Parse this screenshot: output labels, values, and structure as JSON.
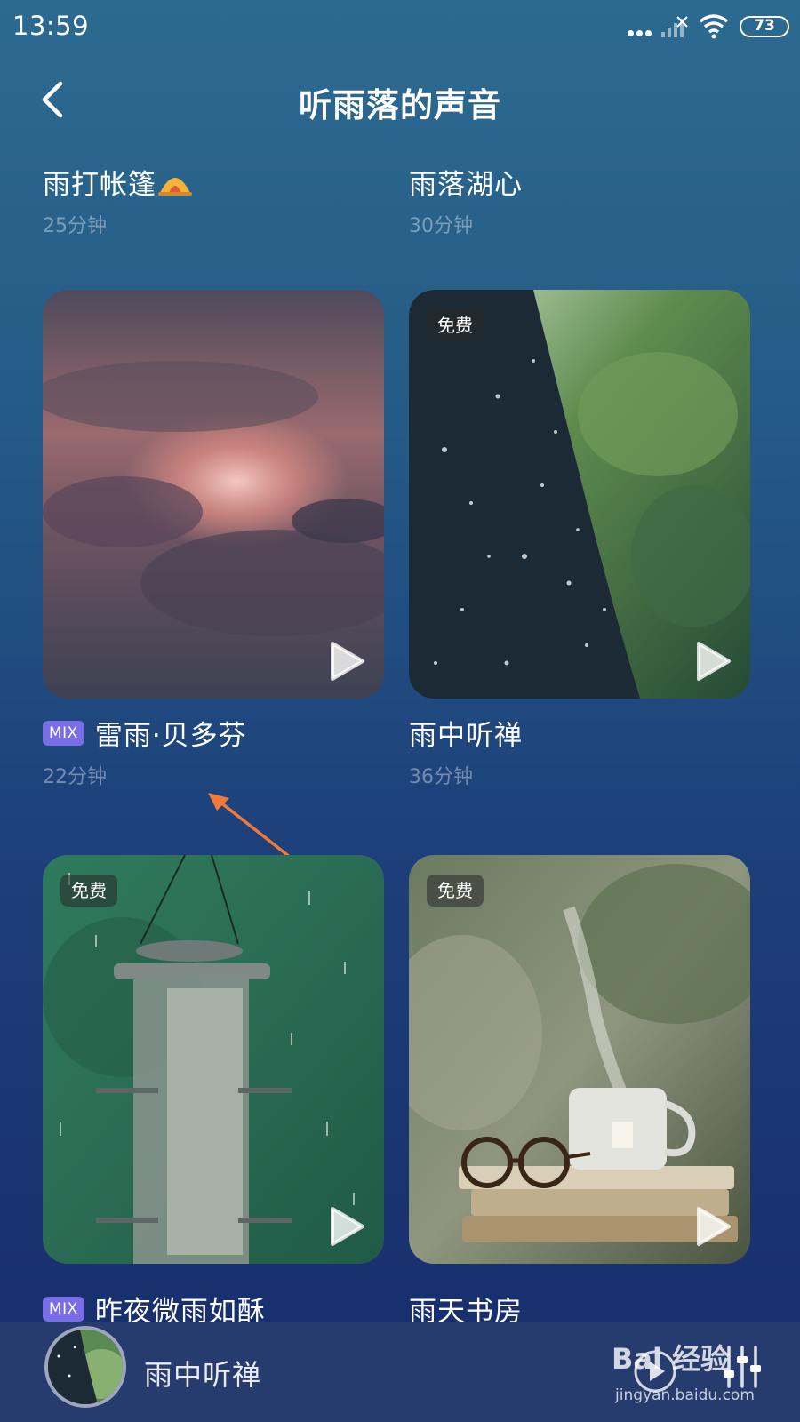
{
  "status_bar": {
    "time": "13:59",
    "battery": "73",
    "icons": [
      "more-dots-icon",
      "signal-icon",
      "wifi-icon",
      "battery-icon"
    ]
  },
  "header": {
    "title": "听雨落的声音",
    "back_icon": "chevron-left-icon"
  },
  "items": [
    {
      "title": "雨打帐篷",
      "emoji_icon": "tent-icon",
      "duration": "25分钟"
    },
    {
      "title": "雨落湖心",
      "duration": "30分钟"
    },
    {
      "title": "雷雨·贝多芬",
      "badge": "MIX",
      "duration": "22分钟",
      "free": false
    },
    {
      "title": "雨中听禅",
      "duration": "36分钟",
      "free_label": "免费"
    },
    {
      "title": "昨夜微雨如酥",
      "badge": "MIX",
      "free_label": "免费"
    },
    {
      "title": "雨天书房",
      "free_label": "免费"
    }
  ],
  "mini_player": {
    "title": "雨中听禅"
  },
  "watermark": {
    "logo": "Bai 经验",
    "url": "jingyan.baidu.com"
  },
  "colors": {
    "bg_top": "#2d6a90",
    "bg_bottom": "#172c6b",
    "mix_badge": "#7a6ee6",
    "arrow": "#f07a3a"
  }
}
